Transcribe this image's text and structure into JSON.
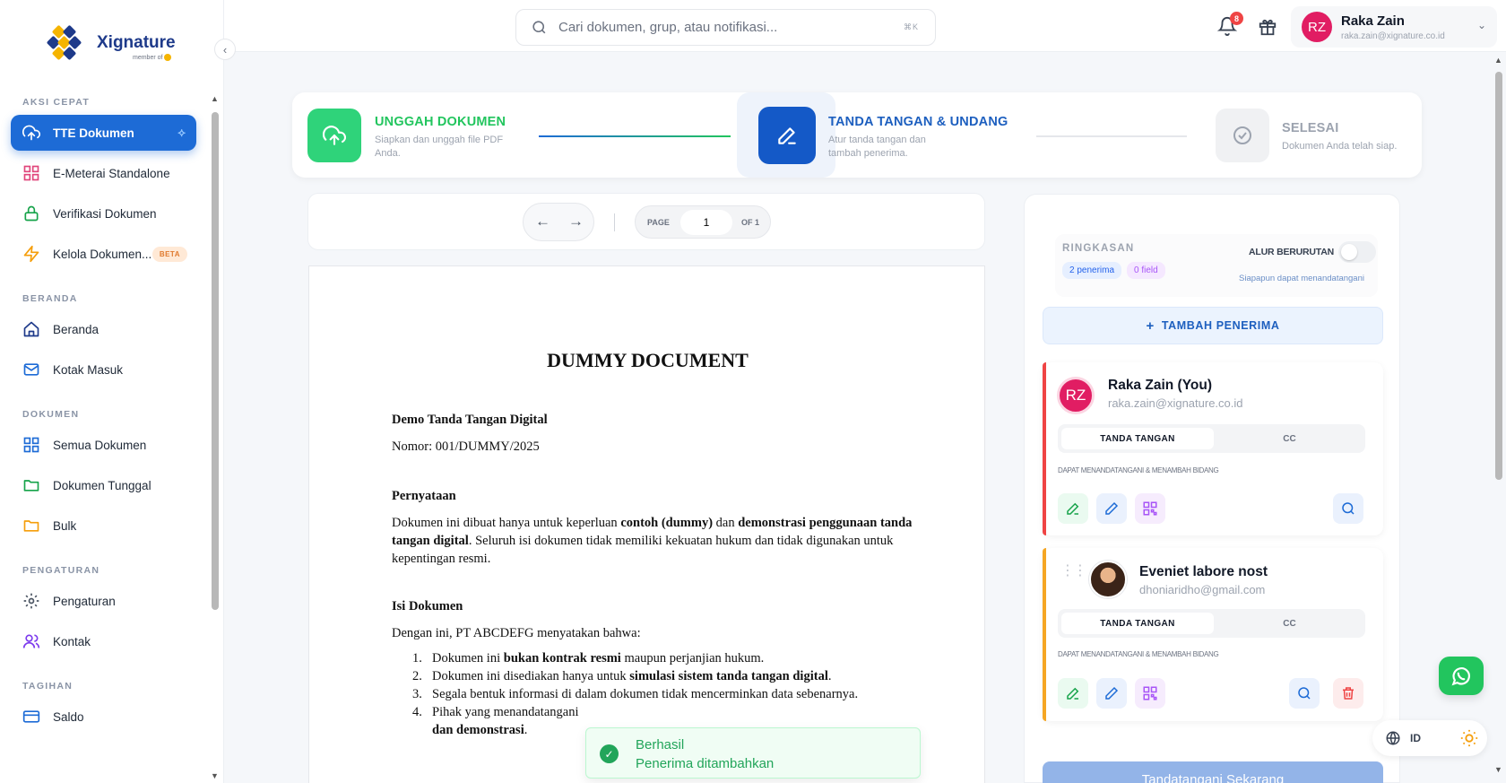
{
  "brand": {
    "name": "Xignature",
    "sub": "member of"
  },
  "sidebar": {
    "sections": [
      {
        "label": "AKSI CEPAT"
      },
      {
        "label": "BERANDA"
      },
      {
        "label": "DOKUMEN"
      },
      {
        "label": "PENGATURAN"
      },
      {
        "label": "TAGIHAN"
      }
    ],
    "items": [
      {
        "label": "TTE Dokumen",
        "icon": "upload-cloud-icon"
      },
      {
        "label": "E-Meterai Standalone",
        "icon": "grid-icon"
      },
      {
        "label": "Verifikasi Dokumen",
        "icon": "lock-icon"
      },
      {
        "label": "Kelola Dokumen...",
        "icon": "bolt-icon",
        "badge": "BETA"
      },
      {
        "label": "Beranda",
        "icon": "home-icon"
      },
      {
        "label": "Kotak Masuk",
        "icon": "mail-icon"
      },
      {
        "label": "Semua Dokumen",
        "icon": "grid-icon"
      },
      {
        "label": "Dokumen Tunggal",
        "icon": "folder-icon"
      },
      {
        "label": "Bulk",
        "icon": "folder-icon"
      },
      {
        "label": "Pengaturan",
        "icon": "gear-icon"
      },
      {
        "label": "Kontak",
        "icon": "users-icon"
      },
      {
        "label": "Saldo",
        "icon": "card-icon"
      }
    ]
  },
  "header": {
    "search_placeholder": "Cari dokumen, grup, atau notifikasi...",
    "shortcut": "⌘K",
    "notifications": "8",
    "user": {
      "initials": "RZ",
      "name": "Raka Zain",
      "email": "raka.zain@xignature.co.id"
    }
  },
  "stepper": [
    {
      "title": "UNGGAH DOKUMEN",
      "desc": "Siapkan dan unggah file PDF Anda.",
      "state": "done",
      "color": "#22c55e"
    },
    {
      "title": "TANDA TANGAN & UNDANG",
      "desc": "Atur tanda tangan dan tambah penerima.",
      "state": "active",
      "color": "#1d5fbf"
    },
    {
      "title": "SELESAI",
      "desc": "Dokumen Anda telah siap.",
      "state": "pending",
      "color": "#9ca3af"
    }
  ],
  "pager": {
    "page_label": "PAGE",
    "page": "1",
    "of": "OF 1"
  },
  "document": {
    "title": "DUMMY DOCUMENT",
    "heading": "Demo Tanda Tangan Digital",
    "number": "Nomor: 001/DUMMY/2025",
    "s1_title": "Pernyataan",
    "s1_p1": "Dokumen ini dibuat hanya untuk keperluan ",
    "s1_b1": "contoh (dummy)",
    "s1_p2": " dan ",
    "s1_b2": "demonstrasi penggunaan tanda tangan digital",
    "s1_p3": ". Seluruh isi dokumen tidak memiliki kekuatan hukum dan tidak digunakan untuk kepentingan resmi.",
    "s2_title": "Isi Dokumen",
    "s2_intro": "Dengan ini, PT ABCDEFG menyatakan bahwa:",
    "l1_a": "Dokumen ini ",
    "l1_b": "bukan kontrak resmi",
    "l1_c": " maupun perjanjian hukum.",
    "l2_a": "Dokumen ini disediakan hanya untuk ",
    "l2_b": "simulasi sistem tanda tangan digital",
    "l2_c": ".",
    "l3": "Segala bentuk informasi di dalam dokumen tidak mencerminkan data sebenarnya.",
    "l4_a": "Pihak yang menandatangani",
    "l4_b": "dan demonstrasi",
    "l4_c": "."
  },
  "toast": {
    "title": "Berhasil",
    "message": "Penerima ditambahkan"
  },
  "panel": {
    "summary_label": "RINGKASAN",
    "recipients_chip": "2 penerima",
    "fields_chip": "0 field",
    "sequential_label": "ALUR BERURUTAN",
    "sequential_sub": "Siapapun dapat menandatangani",
    "add_label": "TAMBAH PENERIMA",
    "recipients": [
      {
        "initials": "RZ",
        "name": "Raka Zain (You)",
        "email": "raka.zain@xignature.co.id",
        "role_on": "TANDA TANGAN",
        "role_off": "CC",
        "perm": "DAPAT MENANDATANGANI & MENAMBAH BIDANG",
        "bar": "#ef4444"
      },
      {
        "name": "Eveniet labore nost",
        "email": "dhoniaridho@gmail.com",
        "role_on": "TANDA TANGAN",
        "role_off": "CC",
        "perm": "DAPAT MENANDATANGANI & MENAMBAH BIDANG",
        "bar": "#f5a623"
      }
    ],
    "sign_now": "Tandatangani Sekarang"
  },
  "floating": {
    "lang": "ID"
  }
}
